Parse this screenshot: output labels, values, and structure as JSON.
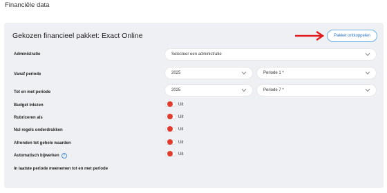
{
  "page": {
    "title": "Financiële data"
  },
  "panel": {
    "title": "Gekozen financieel pakket: Exact Online",
    "unlink_label": "Pakket ontkoppelen"
  },
  "fields": {
    "administratie": {
      "label": "Administratie",
      "value": "Selecteer een administratie"
    },
    "vanaf": {
      "label": "Vanaf periode",
      "year": "2025",
      "period": "Periode 1 *"
    },
    "tot": {
      "label": "Tot en met periode",
      "year": "2025",
      "period": "Periode 7 *"
    }
  },
  "toggles": [
    {
      "label": "Budget inlezen",
      "state": "Uit"
    },
    {
      "label": "Rubriceren als",
      "state": "Uit"
    },
    {
      "label": "Nul regels onderdrukken",
      "state": "Uit"
    },
    {
      "label": "Afronden tot gehele waarden",
      "state": "Uit"
    },
    {
      "label": "Automatisch bijwerken",
      "state": "Uit",
      "help_icon": "question-icon"
    }
  ],
  "last_row": {
    "label": "In laatste periode meenemen tot en met periode"
  },
  "colors": {
    "accent": "#2a72c8",
    "arrow": "#e01b1b",
    "toggle_knob": "#e23b2e",
    "panel_bg": "#eff0f3"
  }
}
